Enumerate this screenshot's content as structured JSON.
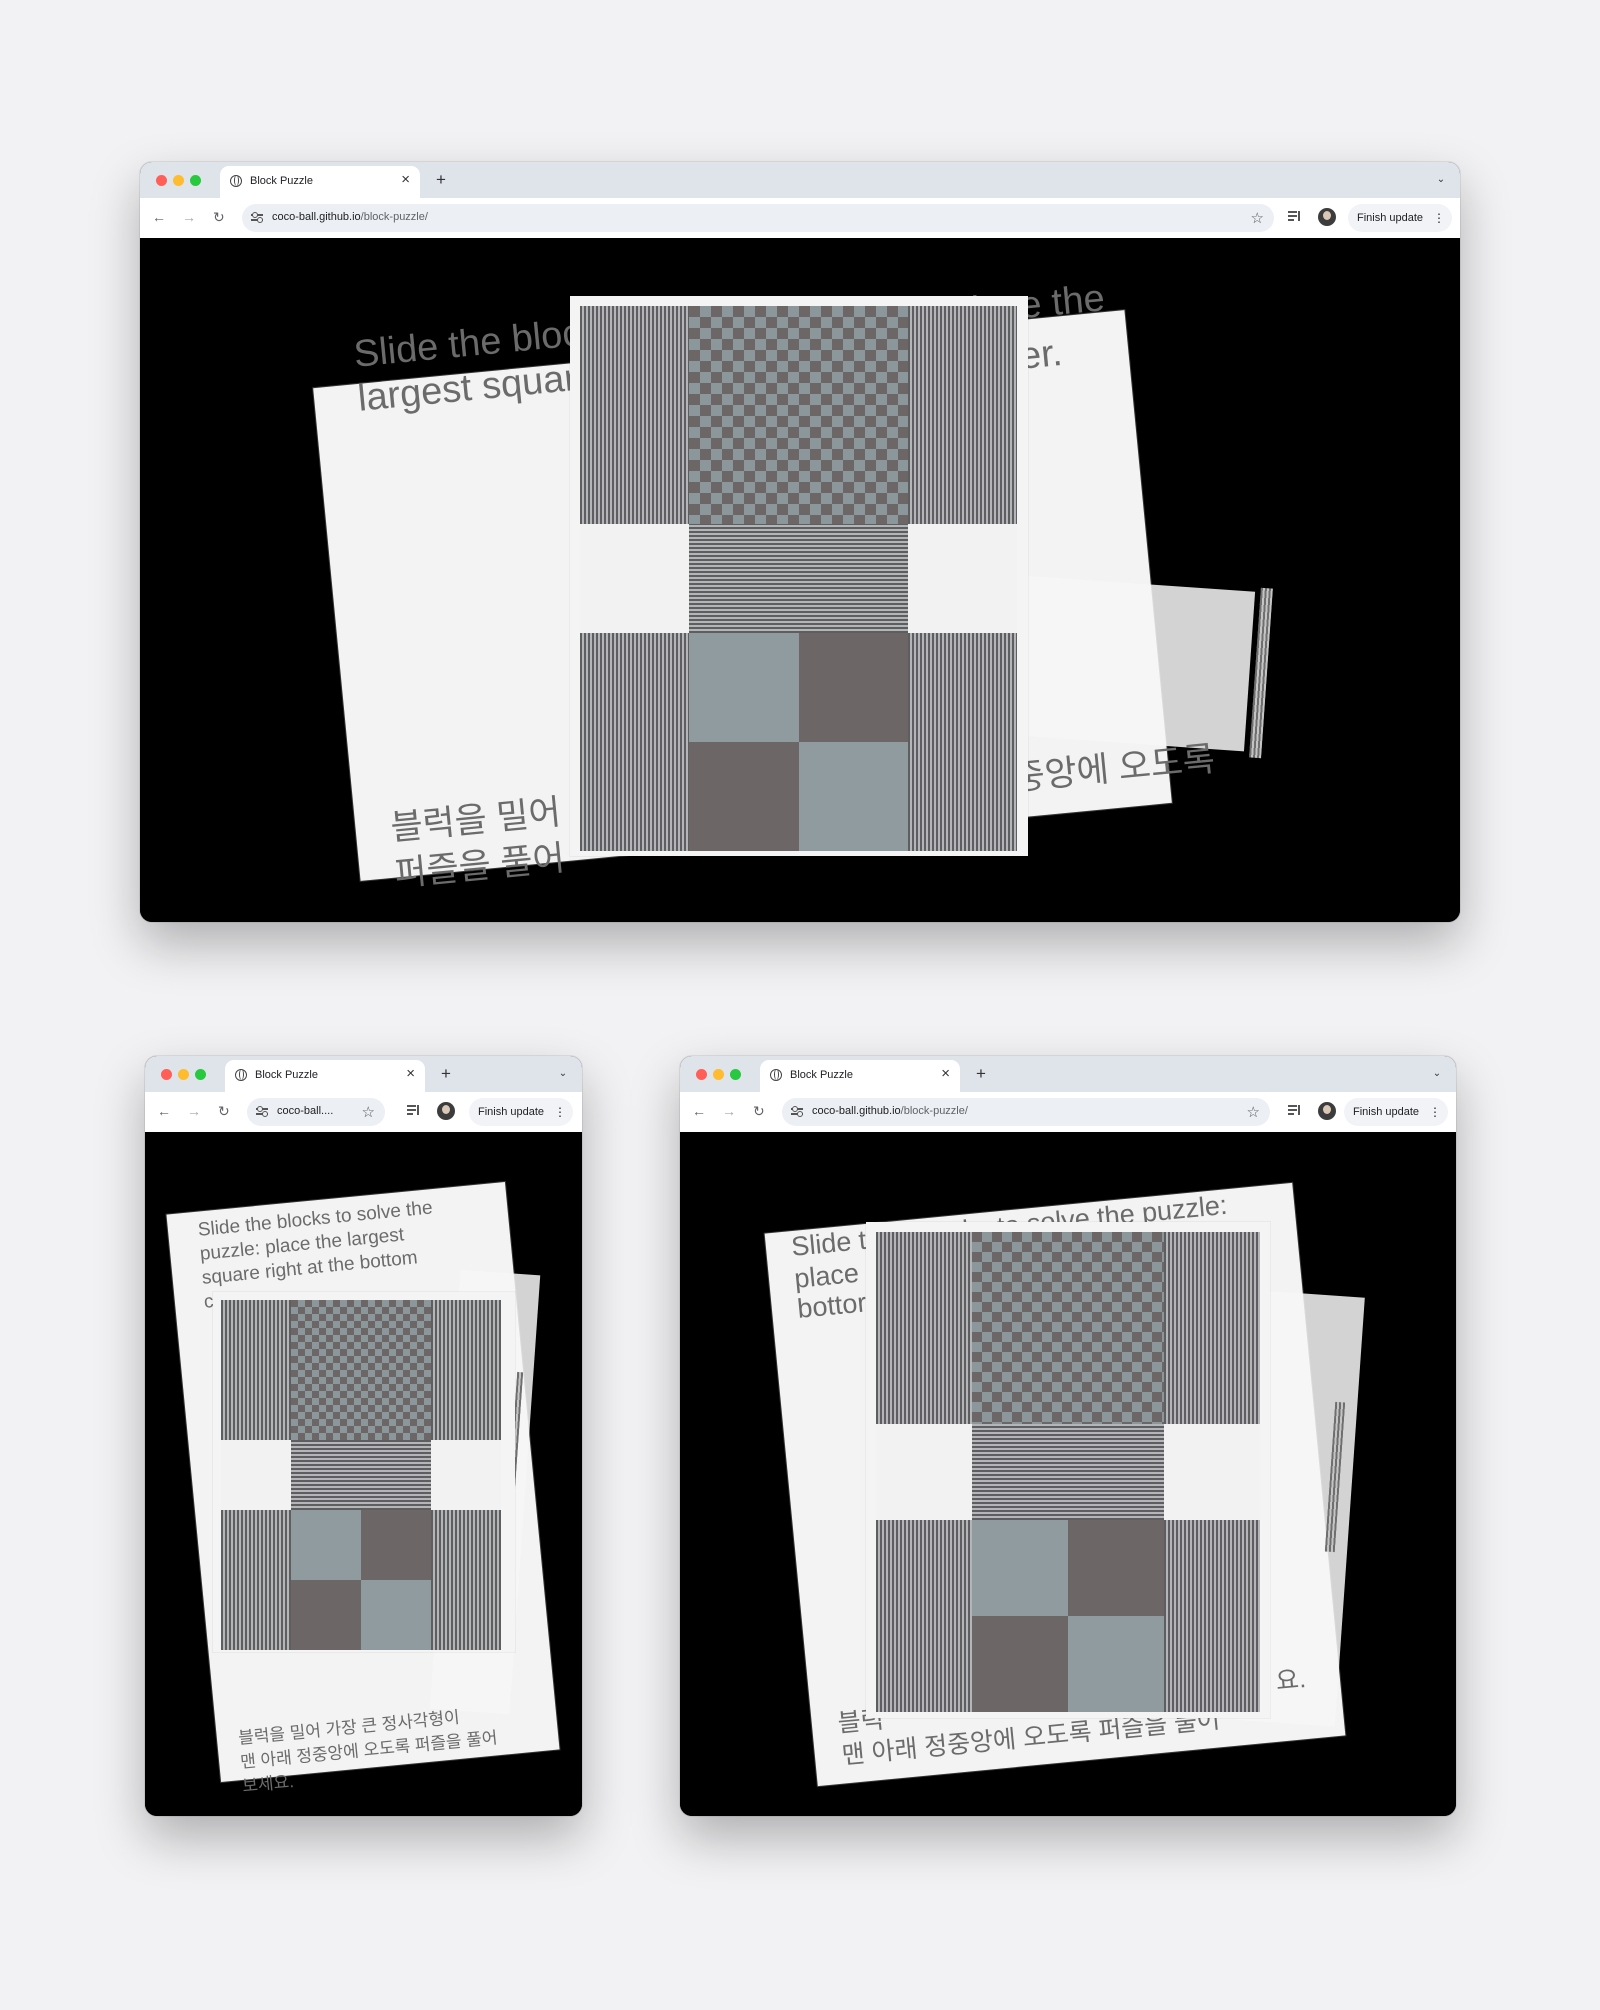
{
  "browser": {
    "tab_title": "Block Puzzle",
    "tab_close": "×",
    "new_tab": "+",
    "tab_menu": "⌄",
    "url_host": "coco-ball.github.io",
    "url_path": "/block-puzzle/",
    "url_truncated": "coco-ball....",
    "update_label": "Finish update",
    "back": "←",
    "forward": "→",
    "reload": "↻",
    "star": "☆",
    "kebab": "⋮"
  },
  "page": {
    "instructions_en": "Slide the blocks to solve the puzzle: place the largest square right at the bottom center.",
    "instructions_ko": "블럭을 밀어 가장 큰 정사각형이 맨 아래 정중앙에 오도록 퍼즐을 풀어 보세요."
  },
  "windows": {
    "large": {
      "en_line1": "Slide the bloc",
      "en_line2": "largest squar",
      "en_right1": "lace the",
      "en_right2": "er.",
      "ko_line1": "블럭을 밀어",
      "ko_line2": "퍼즐을 풀어",
      "ko_right": "중앙에 오도록"
    },
    "small": {
      "en_line1": "Slide the blocks to solve the",
      "en_line2": "puzzle: place the largest",
      "en_line3": "square right at the bottom",
      "en_line4": "center.",
      "ko_line1": "블럭을 밀어 가장 큰 정사각형이",
      "ko_line2": "맨 아래 정중앙에 오도록 퍼즐을 풀어",
      "ko_line3": "보세요."
    },
    "medium": {
      "en_line1a": "Slide t",
      "en_line1b": "blocks to solve the puzzle:",
      "en_line2": "place",
      "en_line3": "bottor",
      "ko_line1a": "블럭",
      "ko_line1b": "요.",
      "ko_line2": "맨 아래 정중앙에 오도록 퍼즐을 풀어"
    }
  },
  "puzzle": {
    "columns": 4,
    "rows": 5,
    "blocks": [
      {
        "name": "vertical-bar-left-top",
        "pattern": "vertical-stripes"
      },
      {
        "name": "largest-square",
        "pattern": "checker"
      },
      {
        "name": "vertical-bar-right-top",
        "pattern": "vertical-stripes"
      },
      {
        "name": "horizontal-bar",
        "pattern": "horizontal-stripes"
      },
      {
        "name": "vertical-bar-left-bottom",
        "pattern": "vertical-stripes"
      },
      {
        "name": "small-square-1",
        "pattern": "light"
      },
      {
        "name": "small-square-2",
        "pattern": "dark"
      },
      {
        "name": "small-square-3",
        "pattern": "dark"
      },
      {
        "name": "small-square-4",
        "pattern": "light"
      },
      {
        "name": "vertical-bar-right-bottom",
        "pattern": "vertical-stripes"
      }
    ]
  },
  "colors": {
    "background": "#f2f2f4",
    "viewport": "#000000",
    "card": "#f3f3f3",
    "tile_light": "#909ba0",
    "tile_dark": "#6d6666",
    "close_dot": "#ff5f57",
    "minimize_dot": "#febc2e",
    "zoom_dot": "#28c840"
  }
}
